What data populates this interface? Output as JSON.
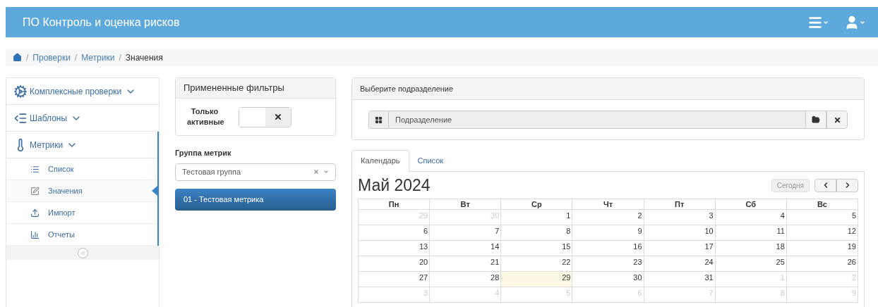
{
  "app": {
    "title": "ПО Контроль и оценка рисков"
  },
  "breadcrumb": {
    "separator": "/",
    "items": [
      "Проверки",
      "Метрики",
      "Значения"
    ]
  },
  "sidebar": {
    "items": [
      {
        "label": "Комплексные проверки",
        "kind": "gear"
      },
      {
        "label": "Шаблоны",
        "kind": "indent"
      },
      {
        "label": "Метрики",
        "kind": "thermometer",
        "children": [
          {
            "label": "Список",
            "kind": "list",
            "selected": false
          },
          {
            "label": "Значения",
            "kind": "edit",
            "selected": true
          },
          {
            "label": "Импорт",
            "kind": "upload",
            "selected": false
          },
          {
            "label": "Отчеты",
            "kind": "chart",
            "selected": false
          }
        ]
      }
    ]
  },
  "filters": {
    "title": "Примененные фильтры",
    "only_active": {
      "label": "Только активные",
      "on": false
    }
  },
  "metric_group": {
    "label": "Группа метрик",
    "value": "Тестовая группа"
  },
  "metrics": [
    {
      "label": "01 - Тестовая метрика",
      "selected": true
    }
  ],
  "unit": {
    "title": "Выберите подразделение",
    "placeholder": "Подразделение"
  },
  "tabs": [
    {
      "label": "Календарь",
      "selected": true
    },
    {
      "label": "Список",
      "selected": false
    }
  ],
  "calendar": {
    "title": "Май 2024",
    "today_button": "Сегодня",
    "weekdays": [
      "Пн",
      "Вт",
      "Ср",
      "Чт",
      "Пт",
      "Сб",
      "Вс"
    ],
    "weeks": [
      [
        {
          "day": "29",
          "other": true,
          "today": false
        },
        {
          "day": "30",
          "other": true,
          "today": false
        },
        {
          "day": "1",
          "other": false,
          "today": false
        },
        {
          "day": "2",
          "other": false,
          "today": false
        },
        {
          "day": "3",
          "other": false,
          "today": false
        },
        {
          "day": "4",
          "other": false,
          "today": false
        },
        {
          "day": "5",
          "other": false,
          "today": false
        }
      ],
      [
        {
          "day": "6",
          "other": false,
          "today": false
        },
        {
          "day": "7",
          "other": false,
          "today": false
        },
        {
          "day": "8",
          "other": false,
          "today": false
        },
        {
          "day": "9",
          "other": false,
          "today": false
        },
        {
          "day": "10",
          "other": false,
          "today": false
        },
        {
          "day": "11",
          "other": false,
          "today": false
        },
        {
          "day": "12",
          "other": false,
          "today": false
        }
      ],
      [
        {
          "day": "13",
          "other": false,
          "today": false
        },
        {
          "day": "14",
          "other": false,
          "today": false
        },
        {
          "day": "15",
          "other": false,
          "today": false
        },
        {
          "day": "16",
          "other": false,
          "today": false
        },
        {
          "day": "17",
          "other": false,
          "today": false
        },
        {
          "day": "18",
          "other": false,
          "today": false
        },
        {
          "day": "19",
          "other": false,
          "today": false
        }
      ],
      [
        {
          "day": "20",
          "other": false,
          "today": false
        },
        {
          "day": "21",
          "other": false,
          "today": false
        },
        {
          "day": "22",
          "other": false,
          "today": false
        },
        {
          "day": "23",
          "other": false,
          "today": false
        },
        {
          "day": "24",
          "other": false,
          "today": false
        },
        {
          "day": "25",
          "other": false,
          "today": false
        },
        {
          "day": "26",
          "other": false,
          "today": false
        }
      ],
      [
        {
          "day": "27",
          "other": false,
          "today": false
        },
        {
          "day": "28",
          "other": false,
          "today": false
        },
        {
          "day": "29",
          "other": false,
          "today": true
        },
        {
          "day": "30",
          "other": false,
          "today": false
        },
        {
          "day": "31",
          "other": false,
          "today": false
        },
        {
          "day": "1",
          "other": true,
          "today": false
        },
        {
          "day": "2",
          "other": true,
          "today": false
        }
      ],
      [
        {
          "day": "3",
          "other": true,
          "today": false
        },
        {
          "day": "4",
          "other": true,
          "today": false
        },
        {
          "day": "5",
          "other": true,
          "today": false
        },
        {
          "day": "6",
          "other": true,
          "today": false
        },
        {
          "day": "7",
          "other": true,
          "today": false
        },
        {
          "day": "8",
          "other": true,
          "today": false
        },
        {
          "day": "9",
          "other": true,
          "today": false
        }
      ]
    ]
  }
}
